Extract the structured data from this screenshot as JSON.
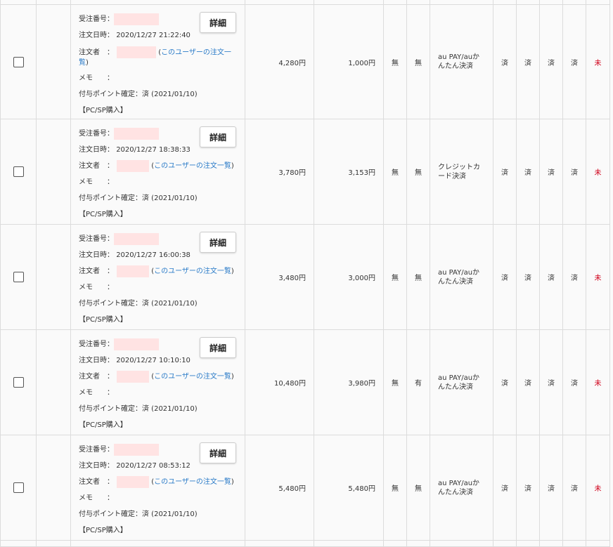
{
  "labels": {
    "order_number": "受注番号：",
    "order_date": "注文日時：",
    "orderer": "注文者　：",
    "memo": "メモ　　：",
    "points_confirmed": "付与ポイント確定：",
    "user_orders_link": "このユーザーの注文一覧",
    "user_orders_link_part1": "このユーザーの注文一",
    "user_orders_link_part2": "覧",
    "paren_open": "(",
    "paren_close": ")",
    "detail_button": "詳細"
  },
  "orders": [
    {
      "date": "2020/12/27 21:22:40",
      "points_status": "済 (2021/01/10)",
      "channel": "【PC/SP購入】",
      "total": "4,280円",
      "amount2": "1,000円",
      "flag1": "無",
      "flag2": "無",
      "payment": "au PAY/auかんたん決済",
      "status1": "済",
      "status2": "済",
      "status3": "済",
      "status4": "済",
      "status5": "未"
    },
    {
      "date": "2020/12/27 18:38:33",
      "points_status": "済 (2021/01/10)",
      "channel": "【PC/SP購入】",
      "total": "3,780円",
      "amount2": "3,153円",
      "flag1": "無",
      "flag2": "無",
      "payment": "クレジットカード決済",
      "status1": "済",
      "status2": "済",
      "status3": "済",
      "status4": "済",
      "status5": "未"
    },
    {
      "date": "2020/12/27 16:00:38",
      "points_status": "済 (2021/01/10)",
      "channel": "【PC/SP購入】",
      "total": "3,480円",
      "amount2": "3,000円",
      "flag1": "無",
      "flag2": "無",
      "payment": "au PAY/auかんたん決済",
      "status1": "済",
      "status2": "済",
      "status3": "済",
      "status4": "済",
      "status5": "未"
    },
    {
      "date": "2020/12/27 10:10:10",
      "points_status": "済 (2021/01/10)",
      "channel": "【PC/SP購入】",
      "total": "10,480円",
      "amount2": "3,980円",
      "flag1": "無",
      "flag2": "有",
      "payment": "au PAY/auかんたん決済",
      "status1": "済",
      "status2": "済",
      "status3": "済",
      "status4": "済",
      "status5": "未"
    },
    {
      "date": "2020/12/27 08:53:12",
      "points_status": "済 (2021/01/10)",
      "channel": "【PC/SP購入】",
      "total": "5,480円",
      "amount2": "5,480円",
      "flag1": "無",
      "flag2": "無",
      "payment": "au PAY/auかんたん決済",
      "status1": "済",
      "status2": "済",
      "status3": "済",
      "status4": "済",
      "status5": "未"
    }
  ]
}
